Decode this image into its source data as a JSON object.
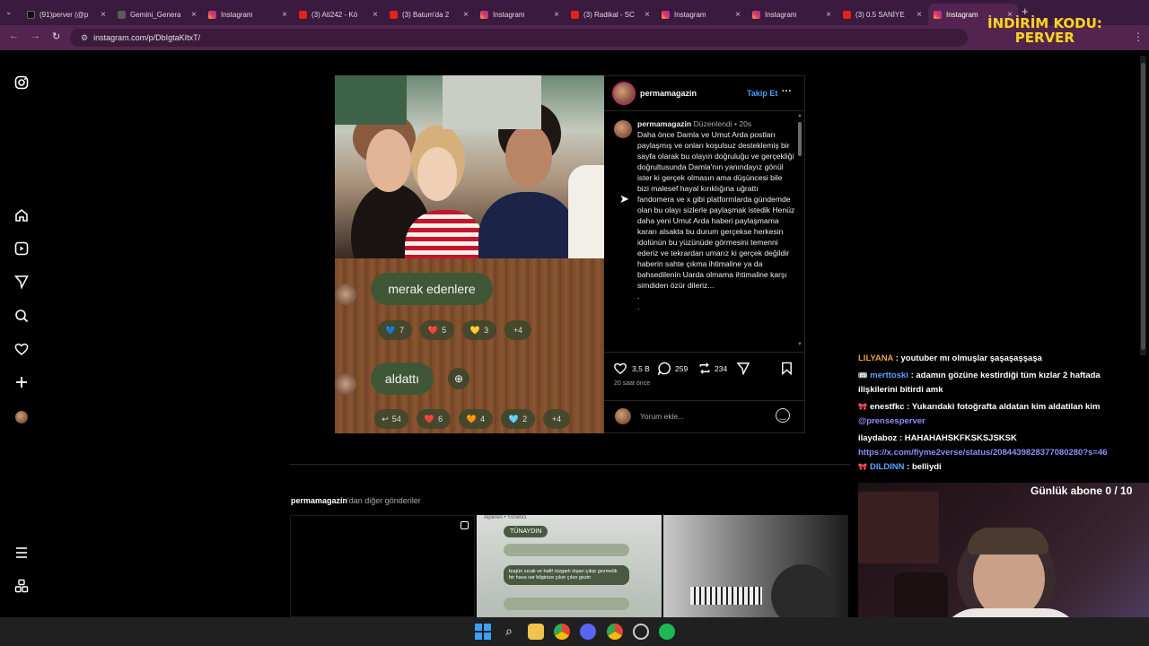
{
  "browser": {
    "tabs": [
      {
        "label": "(91)perver (@p",
        "type": "tiktok"
      },
      {
        "label": "Gemini_Genera",
        "type": "gemini"
      },
      {
        "label": "Instagram",
        "type": "instagram"
      },
      {
        "label": "(3) Ati242 - Kö",
        "type": "youtube"
      },
      {
        "label": "(3) Batum'da 2",
        "type": "youtube"
      },
      {
        "label": "Instagram",
        "type": "instagram"
      },
      {
        "label": "(3) Radikal - SC",
        "type": "youtube"
      },
      {
        "label": "Instagram",
        "type": "instagram"
      },
      {
        "label": "Instagram",
        "type": "instagram"
      },
      {
        "label": "(3) 0.5 SANİYE",
        "type": "youtube"
      },
      {
        "label": "Instagram",
        "type": "instagram",
        "active": true
      }
    ],
    "new_tab": "+",
    "url": "instagram.com/p/DbIgtaKItxT/"
  },
  "overlay": {
    "promo_line1": "İNDİRİM KODU:",
    "promo_line2": "PERVER"
  },
  "post": {
    "username": "permamagazin",
    "follow_label": "Takip Et",
    "more_label": "···",
    "caption_meta": "Düzenlendi  •  20s",
    "caption_text": "Daha önce Damla ve Umut Arda postları paylaşmış ve onları koşulsuz desteklemiş bir sayfa olarak bu olayın doğruluğu ve gerçekliği doğrultusunda Damla'nın yanındayız gönül ister ki gerçek olmasın ama düşüncesi bile bizi malesef hayal kırıklığına uğrattı fandomera ve x gibi platformlarda gündemde olan bu olayı sizlerle paylaşmak istedik Henüz daha yeni Umut Arda haberi paylaşmama kararı alsakta bu durum gerçekse herkesin idolünün bu yüzünüde görmesini temenni ederiz ve tekrardan umarız ki gerçek değildir haberin sahte çıkma ihtimaline ya da bahsedilenin Uarda olmama ihtimaline karşı simdiden özür dileriz...",
    "caption_tail1": ".",
    "caption_tail2": ".",
    "likes": "3,5 B",
    "comments": "259",
    "reposts": "234",
    "time_ago": "20 saat önce",
    "comment_placeholder": "Yorum ekle...",
    "screenshot": {
      "bubble1": "merak edenlere",
      "bubble2": "aldattı",
      "reacts1": [
        {
          "e": "💙",
          "n": "7"
        },
        {
          "e": "❤️",
          "n": "5"
        },
        {
          "e": "💛",
          "n": "3"
        },
        {
          "e": "",
          "n": "+4"
        }
      ],
      "reacts2": [
        {
          "e": "↩",
          "n": "54"
        },
        {
          "e": "❤️",
          "n": "6"
        },
        {
          "e": "🧡",
          "n": "4"
        },
        {
          "e": "🩵",
          "n": "2"
        },
        {
          "e": "",
          "n": "+4"
        }
      ]
    }
  },
  "more_posts": {
    "user": "permamagazin",
    "suffix": "'dan diğer gönderiler",
    "thumb2": {
      "header": "Alperen • Yönetici",
      "name": "TÜNAYDIN",
      "msg": "bugün sıcak ve hafif rüzgarlı dışarı çıkıp gezmelik bir hava var bilginize çıkın çıkın gezin"
    }
  },
  "chat": [
    {
      "user": "LILYANA",
      "color": "#e7a23a",
      "text": ": youtuber mı olmuşlar şaşaşaşşaşa",
      "badge": ""
    },
    {
      "user": "merttoski",
      "color": "#5aa4ff",
      "text": ": adamın gözüne kestirdiği tüm kızlar 2 haftada",
      "badge": "🎟"
    },
    {
      "user": "",
      "color": "#fff",
      "text": "ilişkilerini bitirdi amk",
      "badge": ""
    },
    {
      "user": "enestfkc",
      "color": "#ffffff",
      "text": ": Yukarıdaki fotoğrafta aldatan kim aldatilan kim",
      "badge": "🎀"
    },
    {
      "user": "@prensesperver",
      "color": "#8d8dff",
      "text": "",
      "badge": ""
    },
    {
      "user": "ilaydaboz",
      "color": "#ffffff",
      "text": ": HAHAHAHSKFKSKSJSKSK",
      "badge": ""
    },
    {
      "user": "",
      "color": "#8d8dff",
      "text": "https://x.com/flyme2verse/status/2084439828377080280?s=46",
      "badge": ""
    },
    {
      "user": "DILDINN",
      "color": "#5aa4ff",
      "text": ": belliydi",
      "badge": "🎀"
    }
  ],
  "cam": {
    "subs": "Günlük abone 0 / 10"
  }
}
